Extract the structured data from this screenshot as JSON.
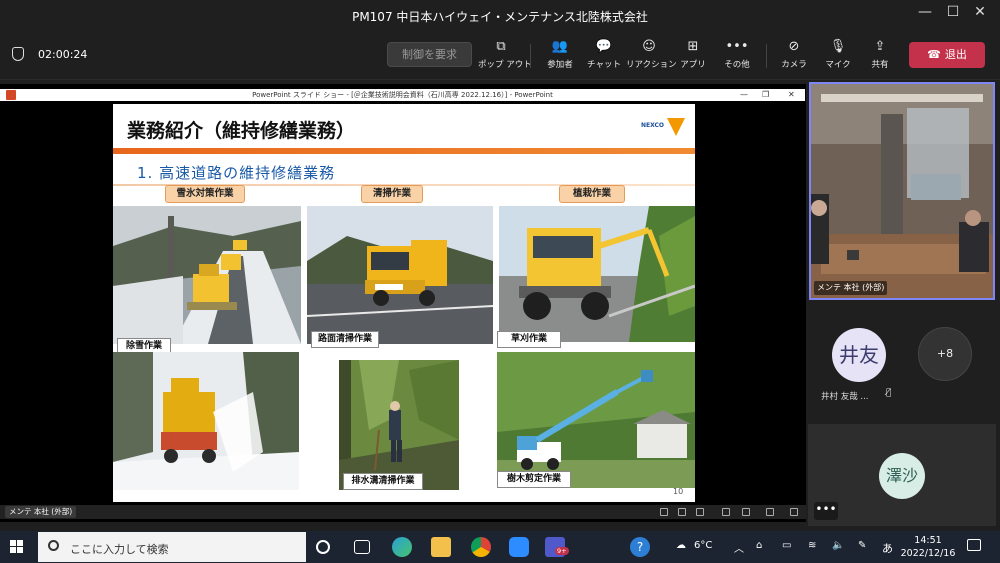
{
  "window": {
    "title": "PM107 中日本ハイウェイ・メンテナンス北陸株式会社",
    "min": "—",
    "max": "☐",
    "close": "✕"
  },
  "toolbar": {
    "timer": "02:00:24",
    "request_control": "制御を要求",
    "buttons": [
      {
        "icon": "popout-icon",
        "glyph": "⧉",
        "label": "ポップ アウト"
      },
      {
        "icon": "participants-icon",
        "glyph": "👥",
        "label": "参加者"
      },
      {
        "icon": "chat-icon",
        "glyph": "💬",
        "label": "チャット"
      },
      {
        "icon": "reaction-icon",
        "glyph": "☺",
        "label": "リアクション"
      },
      {
        "icon": "apps-icon",
        "glyph": "⊞",
        "label": "アプリ"
      },
      {
        "icon": "more-icon",
        "glyph": "•••",
        "label": "その他"
      },
      {
        "icon": "camera-off-icon",
        "glyph": "⊘",
        "label": "カメラ"
      },
      {
        "icon": "mic-off-icon",
        "glyph": "🎙",
        "label": "マイク"
      },
      {
        "icon": "share-icon",
        "glyph": "⇪",
        "label": "共有"
      }
    ],
    "leave": "退出",
    "leave_icon": "☎"
  },
  "ppt": {
    "window_title": "PowerPoint スライド ショー - [＠企業技術説明会資料（石川高専 2022.12.16）] - PowerPoint",
    "presenter_label": "メンテ 本社 (外部)"
  },
  "slide": {
    "heading": "業務紹介（維持修繕業務）",
    "logo_text": "NEXCO",
    "subheading": "1. 高速道路の維持修繕業務",
    "categories": [
      "雪氷対策作業",
      "清掃作業",
      "植栽作業"
    ],
    "captions": [
      "除雪作業",
      "路面清掃作業",
      "草刈作業",
      "排水溝清掃作業",
      "樹木剪定作業"
    ],
    "page_number": "10"
  },
  "participants": {
    "video_label": "メンテ 本社 (外部)",
    "p1_initials": "井友",
    "p1_name": "井村 友哉 ...",
    "more_count": "+8",
    "p2_initials": "澤沙",
    "tile_more": "•••"
  },
  "taskbar": {
    "search_placeholder": "ここに入力して検索",
    "teams_badge": "9+",
    "weather": "6°C",
    "ime": "あ",
    "time": "14:51",
    "date": "2022/12/16"
  },
  "colors": {
    "accent": "#7f85f5",
    "leave": "#c4314b",
    "slide_bar": "#e8661b",
    "subheading": "#1a5aa8"
  }
}
